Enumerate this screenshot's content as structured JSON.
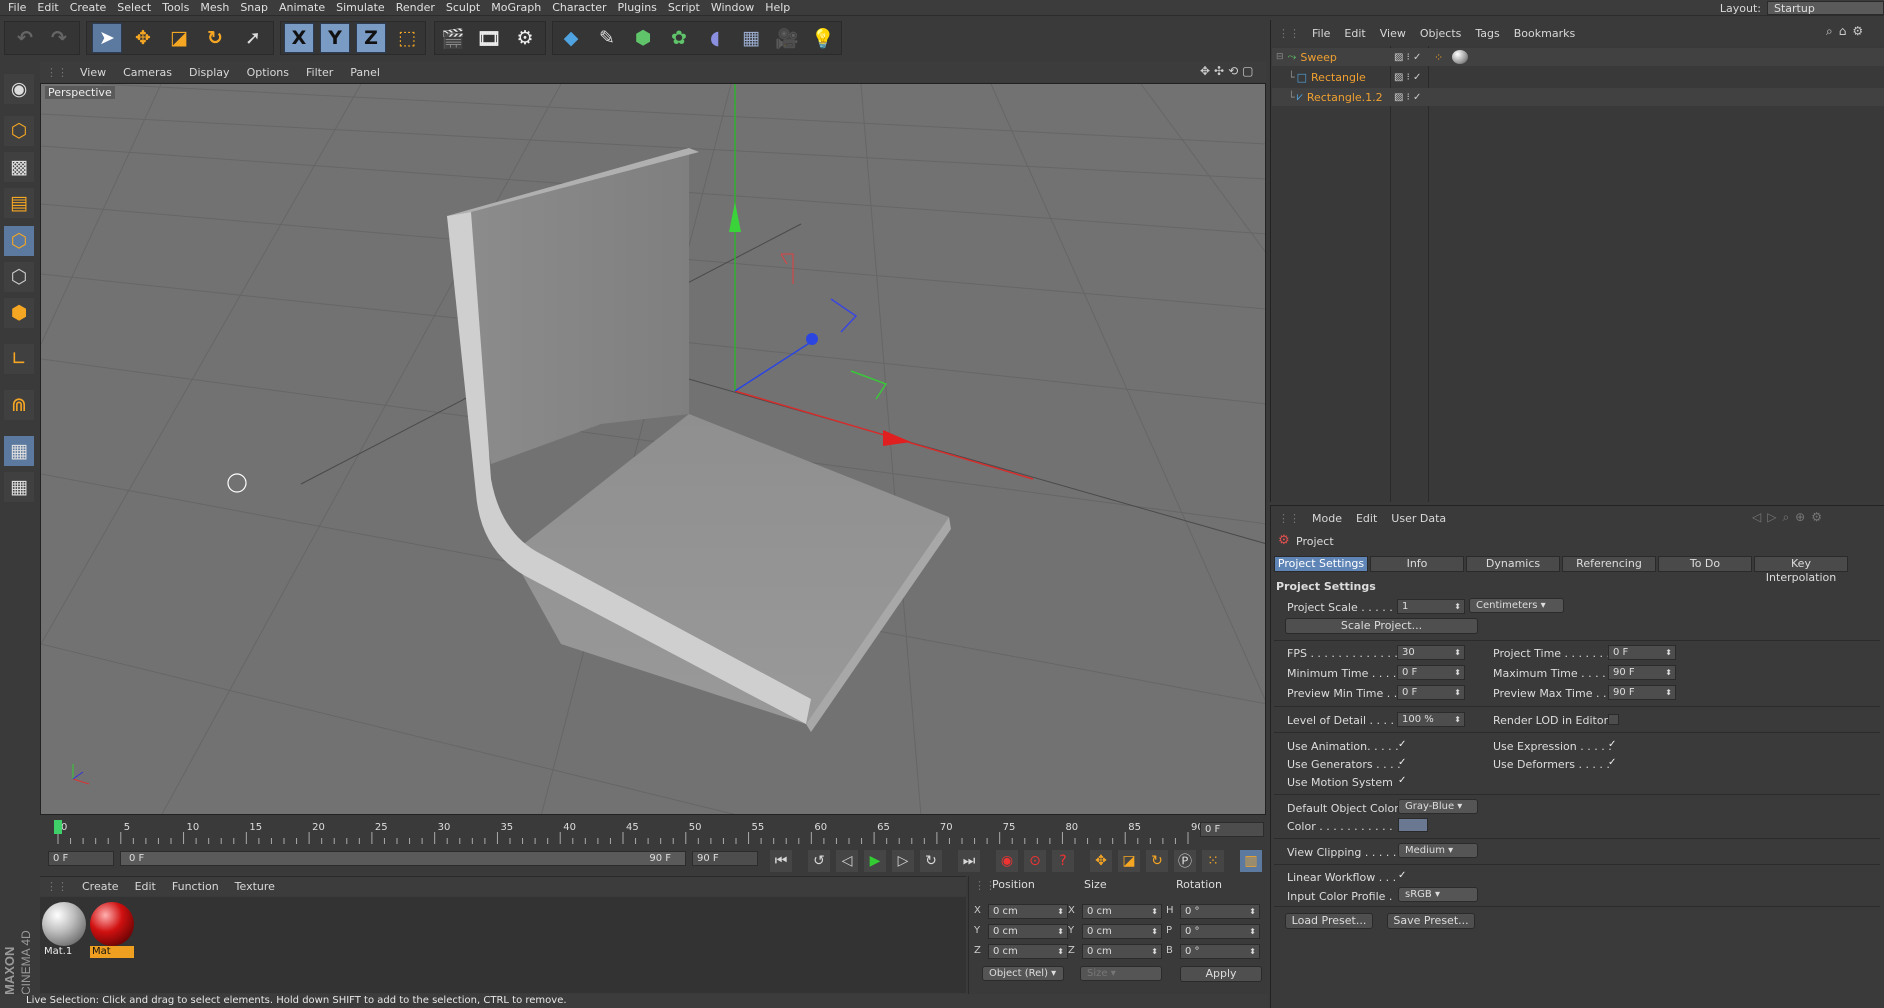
{
  "menubar": {
    "items": [
      "File",
      "Edit",
      "Create",
      "Select",
      "Tools",
      "Mesh",
      "Snap",
      "Animate",
      "Simulate",
      "Render",
      "Sculpt",
      "MoGraph",
      "Character",
      "Plugins",
      "Script",
      "Window",
      "Help"
    ],
    "layout_label": "Layout:",
    "layout_value": "Startup"
  },
  "toolbar": {
    "axis_x": "X",
    "axis_y": "Y",
    "axis_z": "Z"
  },
  "viewport": {
    "menu": [
      "View",
      "Cameras",
      "Display",
      "Options",
      "Filter",
      "Panel"
    ],
    "camera_label": "Perspective"
  },
  "timeline": {
    "ticks": [
      "0",
      "5",
      "10",
      "15",
      "20",
      "25",
      "30",
      "35",
      "40",
      "45",
      "50",
      "55",
      "60",
      "65",
      "70",
      "75",
      "80",
      "85",
      "90"
    ],
    "current_frame": "0 F",
    "start_field": "0 F",
    "range_start": "0 F",
    "range_end": "90 F",
    "end_field": "90 F"
  },
  "materials": {
    "menu": [
      "Create",
      "Edit",
      "Function",
      "Texture"
    ],
    "items": [
      {
        "name": "Mat.1"
      },
      {
        "name": "Mat"
      }
    ]
  },
  "coordinates": {
    "headers": {
      "position": "Position",
      "size": "Size",
      "rotation": "Rotation"
    },
    "rows": [
      {
        "pl": "X",
        "pv": "0 cm",
        "sl": "X",
        "sv": "0 cm",
        "rl": "H",
        "rv": "0 °"
      },
      {
        "pl": "Y",
        "pv": "0 cm",
        "sl": "Y",
        "sv": "0 cm",
        "rl": "P",
        "rv": "0 °"
      },
      {
        "pl": "Z",
        "pv": "0 cm",
        "sl": "Z",
        "sv": "0 cm",
        "rl": "B",
        "rv": "0 °"
      }
    ],
    "mode": "Object (Rel)",
    "size_mode": "Size",
    "apply": "Apply"
  },
  "status": "Live Selection: Click and drag to select elements. Hold down SHIFT to add to the selection, CTRL to remove.",
  "objects": {
    "menu": [
      "File",
      "Edit",
      "View",
      "Objects",
      "Tags",
      "Bookmarks"
    ],
    "list": [
      {
        "name": "Sweep"
      },
      {
        "name": "Rectangle"
      },
      {
        "name": "Rectangle.1.2"
      }
    ]
  },
  "attributes": {
    "menu": [
      "Mode",
      "Edit",
      "User Data"
    ],
    "title": "Project",
    "tabs": [
      "Project Settings",
      "Info",
      "Dynamics",
      "Referencing",
      "To Do",
      "Key Interpolation"
    ],
    "section": "Project Settings",
    "project_scale_label": "Project Scale . . . . . .",
    "project_scale_value": "1",
    "project_scale_unit": "Centimeters",
    "scale_project_btn": "Scale Project...",
    "fps_label": "FPS . . . . . . . . . . . . . . .",
    "fps_value": "30",
    "project_time_label": "Project Time . . . . . . .",
    "project_time_value": "0 F",
    "min_time_label": "Minimum Time . . . .",
    "min_time_value": "0 F",
    "max_time_label": "Maximum Time . . . .",
    "max_time_value": "90 F",
    "prev_min_label": "Preview Min Time . .",
    "prev_min_value": "0 F",
    "prev_max_label": "Preview Max Time . .",
    "prev_max_value": "90 F",
    "lod_label": "Level of Detail . . . . .",
    "lod_value": "100 %",
    "render_lod_label": "Render LOD in Editor",
    "use_anim_label": "Use Animation. . . . .",
    "use_expr_label": "Use Expression . . . . .",
    "use_gen_label": "Use Generators . . . .",
    "use_def_label": "Use Deformers . . . . .",
    "use_motion_label": "Use Motion System",
    "def_color_label": "Default Object Color",
    "def_color_value": "Gray-Blue",
    "color_label": "Color . . . . . . . . . . .",
    "view_clip_label": "View Clipping . . . . .",
    "view_clip_value": "Medium",
    "linear_label": "Linear Workflow . . .",
    "input_profile_label": "Input Color Profile .",
    "input_profile_value": "sRGB",
    "load_preset": "Load Preset...",
    "save_preset": "Save Preset..."
  },
  "colors": {
    "accent": "#5f84b6",
    "object_name": "#f0a030",
    "swatch": "#6a7891"
  }
}
